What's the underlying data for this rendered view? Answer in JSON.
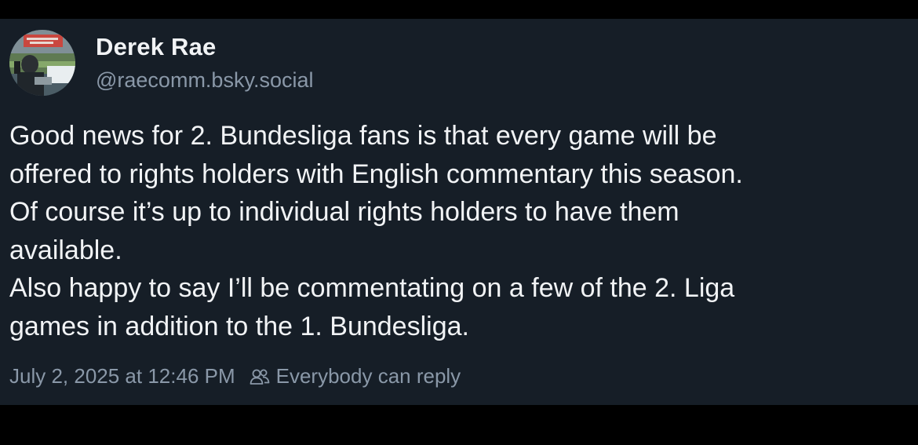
{
  "author": {
    "display_name": "Derek Rae",
    "handle": "@raecomm.bsky.social",
    "avatar_icon": "profile-photo-avatar"
  },
  "post": {
    "text_lines": [
      "Good news for 2. Bundesliga fans is that every game will be",
      "offered to rights holders with English commentary this season.",
      "Of course it’s up to individual rights holders to have them",
      "available.",
      "Also happy to say I’ll be commentating on a few of the 2. Liga",
      "games in addition to the 1. Bundesliga."
    ],
    "timestamp": "July 2, 2025 at 12:46 PM",
    "reply_setting": "Everybody can reply",
    "reply_icon": "people-icon"
  },
  "colors": {
    "background": "#161e27",
    "text": "#f1f3f5",
    "muted": "#8a98a8"
  }
}
